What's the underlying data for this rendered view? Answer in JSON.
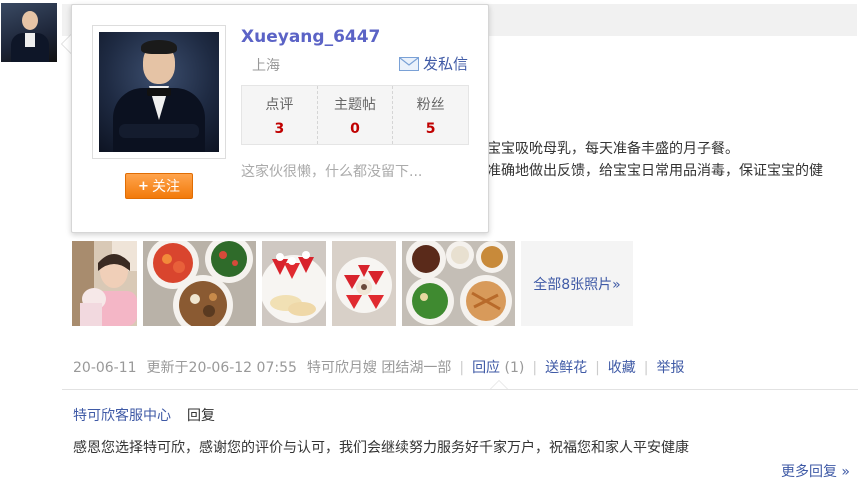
{
  "review": {
    "text_line1": "宝宝吸吮母乳，每天准备丰盛的月子餐。",
    "text_line2": "准确地做出反馈，给宝宝日常用品消毒，保证宝宝的健"
  },
  "photos": {
    "all_label": "全部8张照片»"
  },
  "meta": {
    "date": "20-06-11",
    "updated": "更新于20-06-12 07:55",
    "shop": "特可欣月嫂 团结湖一部",
    "reply_label": "回应",
    "reply_count": "(1)",
    "flower_label": "送鲜花",
    "collect_label": "收藏",
    "report_label": "举报"
  },
  "reply": {
    "author": "特可欣客服中心",
    "label": "回复",
    "text": "感恩您选择特可欣，感谢您的评价与认可，我们会继续努力服务好千家万户，祝福您和家人平安健康",
    "more_label": "更多回复 »"
  },
  "card": {
    "username": "Xueyang_6447",
    "city": "上海",
    "pm_label": "发私信",
    "follow_label": "关注",
    "follow_plus": "+",
    "bio": "这家伙很懒，什么都没留下...",
    "stats": [
      {
        "name": "点评",
        "value": "3"
      },
      {
        "name": "主题帖",
        "value": "0"
      },
      {
        "name": "粉丝",
        "value": "5"
      }
    ]
  },
  "colors": {
    "link": "#3f5aa6",
    "username": "#5b63c6",
    "count": "#c00000",
    "follow_button": "#f27a0a"
  }
}
